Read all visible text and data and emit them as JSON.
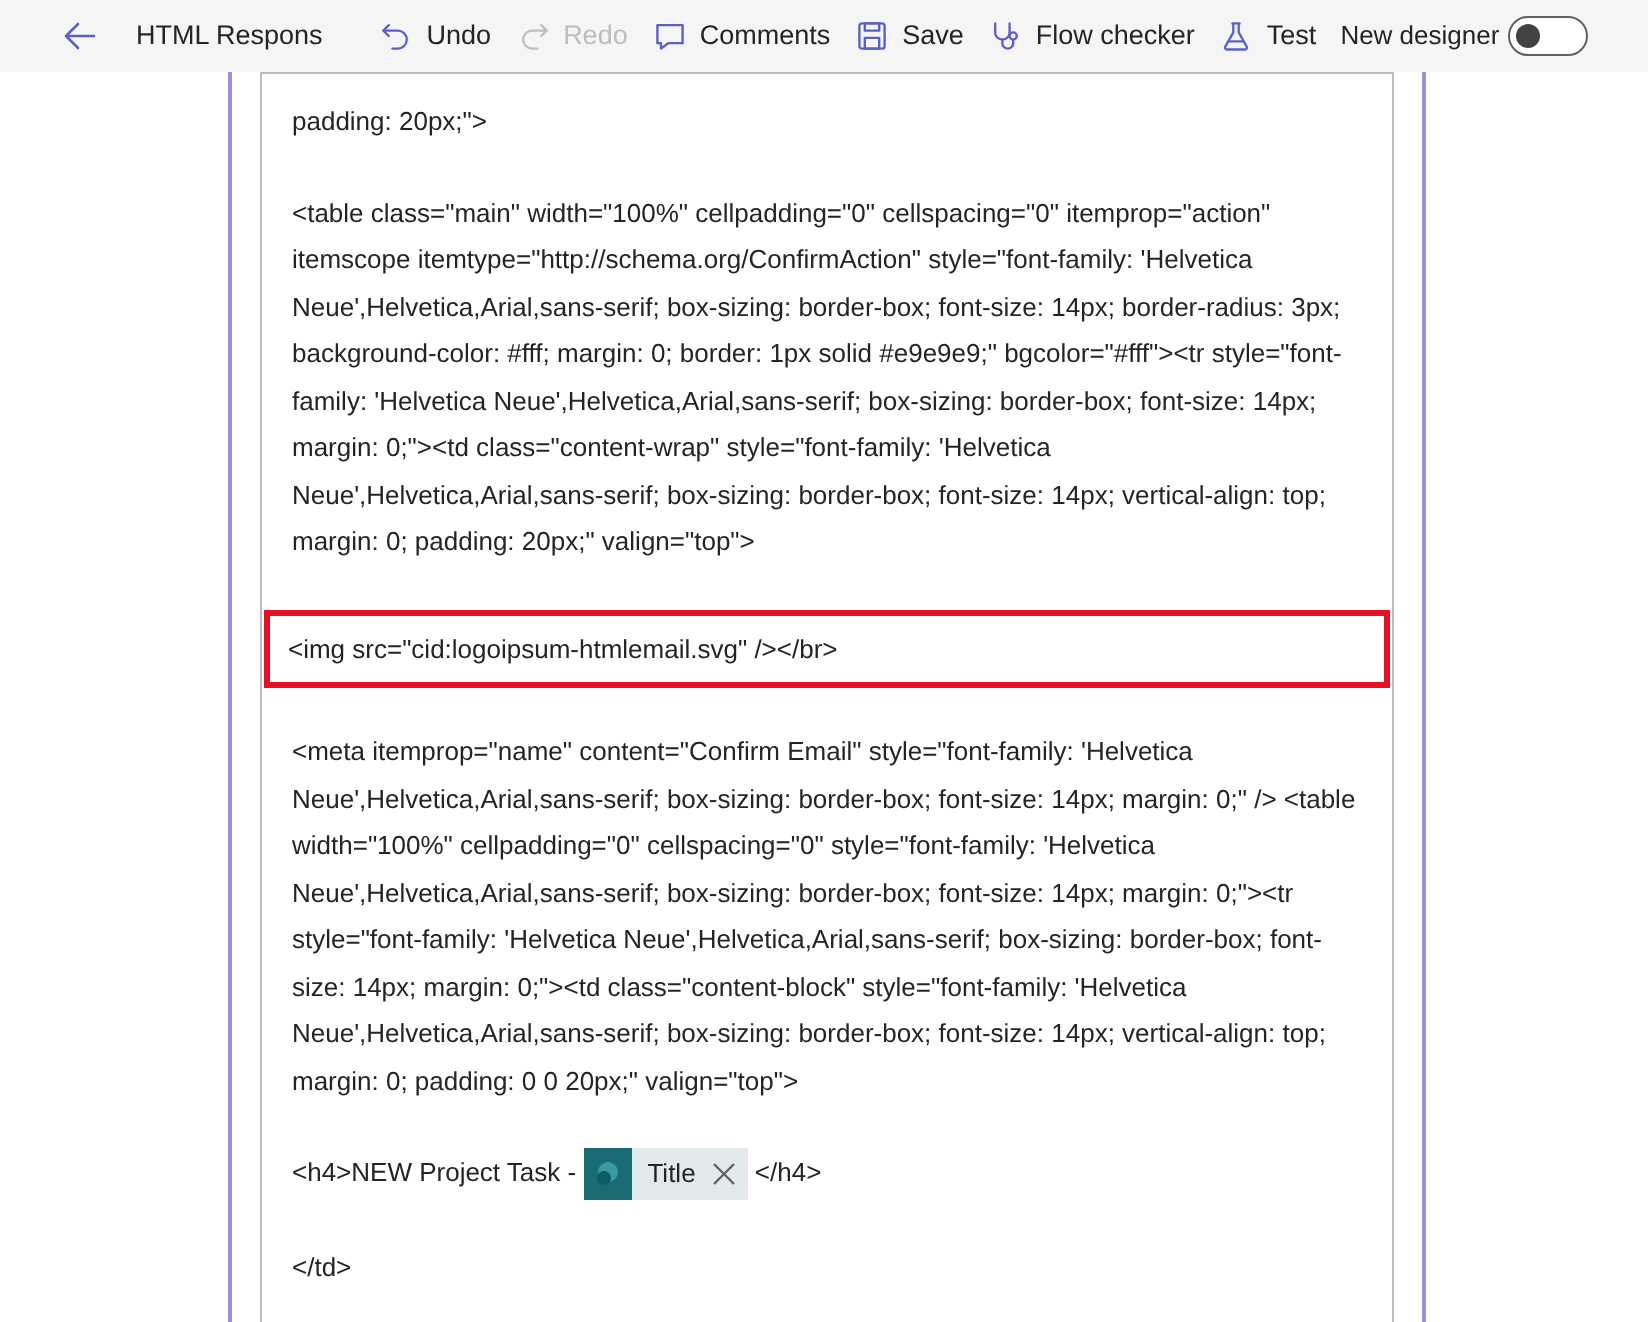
{
  "toolbar": {
    "back": {
      "label": "HTML Respons"
    },
    "actions": [
      {
        "kind": "undo",
        "label": "Undo",
        "disabled": false
      },
      {
        "kind": "redo",
        "label": "Redo",
        "disabled": true
      },
      {
        "kind": "comments",
        "label": "Comments",
        "disabled": false
      },
      {
        "kind": "save",
        "label": "Save",
        "disabled": false
      },
      {
        "kind": "checker",
        "label": "Flow checker",
        "disabled": false
      },
      {
        "kind": "test",
        "label": "Test",
        "disabled": false
      }
    ],
    "toggle": {
      "label": "New designer",
      "on": false
    }
  },
  "editor": {
    "paragraphs": [
      {
        "kind": "text",
        "highlighted": false,
        "text": "padding: 20px;\">"
      },
      {
        "kind": "text",
        "highlighted": false,
        "text": "<table class=\"main\" width=\"100%\" cellpadding=\"0\" cellspacing=\"0\" itemprop=\"action\" itemscope itemtype=\"http://schema.org/ConfirmAction\" style=\"font-family: 'Helvetica Neue',Helvetica,Arial,sans-serif; box-sizing: border-box; font-size: 14px; border-radius: 3px; background-color: #fff; margin: 0; border: 1px solid #e9e9e9;\" bgcolor=\"#fff\"><tr style=\"font-family: 'Helvetica Neue',Helvetica,Arial,sans-serif; box-sizing: border-box; font-size: 14px; margin: 0;\"><td class=\"content-wrap\" style=\"font-family: 'Helvetica Neue',Helvetica,Arial,sans-serif; box-sizing: border-box; font-size: 14px; vertical-align: top; margin: 0; padding: 20px;\" valign=\"top\">"
      },
      {
        "kind": "text",
        "highlighted": true,
        "text": "<img src=\"cid:logoipsum-htmlemail.svg\" /></br>"
      },
      {
        "kind": "text",
        "highlighted": false,
        "text": "<meta itemprop=\"name\" content=\"Confirm Email\" style=\"font-family: 'Helvetica Neue',Helvetica,Arial,sans-serif; box-sizing: border-box; font-size: 14px; margin: 0;\" /> <table width=\"100%\" cellpadding=\"0\" cellspacing=\"0\" style=\"font-family: 'Helvetica Neue',Helvetica,Arial,sans-serif; box-sizing: border-box; font-size: 14px; margin: 0;\"><tr style=\"font-family: 'Helvetica Neue',Helvetica,Arial,sans-serif; box-sizing: border-box; font-size: 14px; margin: 0;\"><td class=\"content-block\" style=\"font-family: 'Helvetica Neue',Helvetica,Arial,sans-serif; box-sizing: border-box; font-size: 14px; vertical-align: top; margin: 0; padding: 0 0 20px;\" valign=\"top\">"
      },
      {
        "kind": "token_line",
        "highlighted": false,
        "before": "<h4>NEW Project Task -",
        "token": {
          "label": "Title"
        },
        "after": "</h4>"
      },
      {
        "kind": "text",
        "highlighted": false,
        "text": "</td>"
      }
    ]
  }
}
